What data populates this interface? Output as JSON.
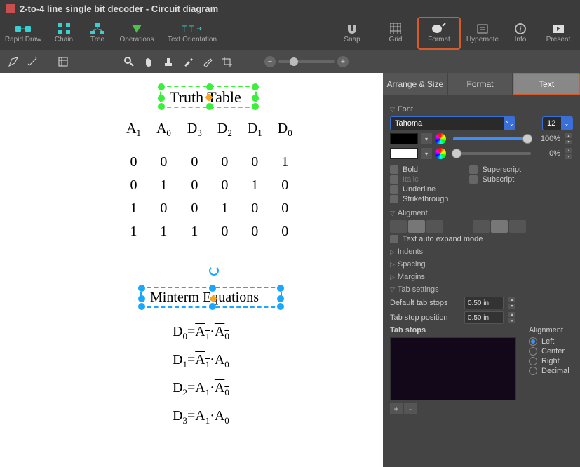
{
  "title": "2-to-4 line single bit decoder - Circuit diagram",
  "main_toolbar_left": [
    {
      "label": "Rapid Draw"
    },
    {
      "label": "Chain"
    },
    {
      "label": "Tree"
    },
    {
      "label": "Operations"
    },
    {
      "label": "Text Orientation"
    }
  ],
  "main_toolbar_right": [
    {
      "label": "Snap"
    },
    {
      "label": "Grid"
    },
    {
      "label": "Format",
      "highlight": true
    },
    {
      "label": "Hypernote"
    },
    {
      "label": "Info"
    },
    {
      "label": "Present"
    }
  ],
  "inspector_tabs": {
    "arrange": "Arrange & Size",
    "format": "Format",
    "text": "Text"
  },
  "font": {
    "section": "Font",
    "family": "Tahoma",
    "size": "12",
    "opacity_fill": "100%",
    "opacity_bg": "0%",
    "bold": "Bold",
    "italic": "Italic",
    "underline": "Underline",
    "strike": "Strikethrough",
    "super": "Superscript",
    "sub": "Subscript"
  },
  "alignment": {
    "section": "Aligment",
    "auto": "Text auto expand mode"
  },
  "collapsed": {
    "indents": "Indents",
    "spacing": "Spacing",
    "margins": "Margins"
  },
  "tabs": {
    "section": "Tab settings",
    "default": "Default tab stops",
    "default_val": "0.50 in",
    "pos": "Tab stop position",
    "pos_val": "0.50 in",
    "stops": "Tab stops",
    "align_label": "Alignment",
    "left": "Left",
    "center": "Center",
    "right": "Right",
    "decimal": "Decimal"
  },
  "pm": {
    "plus": "+",
    "minus": "-"
  },
  "canvas": {
    "truth_title": "Truth Table",
    "minterm_title": "Minterm Equations"
  },
  "chart_data": {
    "type": "table",
    "title": "Truth Table",
    "columns": [
      "A1",
      "A0",
      "D3",
      "D2",
      "D1",
      "D0"
    ],
    "rows": [
      [
        0,
        0,
        0,
        0,
        0,
        1
      ],
      [
        0,
        1,
        0,
        0,
        1,
        0
      ],
      [
        1,
        0,
        0,
        1,
        0,
        0
      ],
      [
        1,
        1,
        1,
        0,
        0,
        0
      ]
    ],
    "equations": [
      "D0 = !A1 · !A0",
      "D1 = !A1 · A0",
      "D2 = A1 · !A0",
      "D3 = A1 · A0"
    ]
  }
}
